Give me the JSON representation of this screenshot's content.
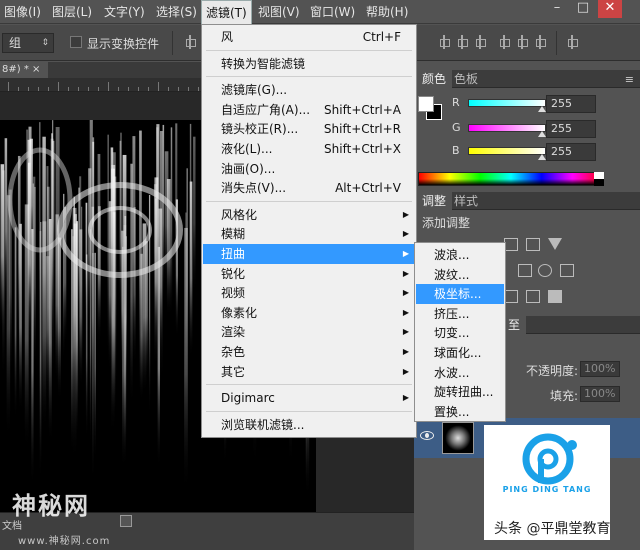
{
  "menubar": {
    "items": [
      "图像(I)",
      "图层(L)",
      "文字(Y)",
      "选择(S)",
      "滤镜(T)",
      "视图(V)",
      "窗口(W)",
      "帮助(H)"
    ],
    "active_index": 4,
    "window_controls": [
      "–",
      "□",
      "✕"
    ]
  },
  "options": {
    "auto_select_value": "组",
    "show_transform_label": "显示变换控件",
    "show_transform_checked": false
  },
  "document": {
    "tab_label": "8#) * ×",
    "status_text": "文档"
  },
  "filter_menu": {
    "items": [
      {
        "label": "风",
        "shortcut": "Ctrl+F"
      },
      {
        "separator": true
      },
      {
        "label": "转换为智能滤镜"
      },
      {
        "separator": true
      },
      {
        "label": "滤镜库(G)..."
      },
      {
        "label": "自适应广角(A)...",
        "shortcut": "Shift+Ctrl+A"
      },
      {
        "label": "镜头校正(R)...",
        "shortcut": "Shift+Ctrl+R"
      },
      {
        "label": "液化(L)...",
        "shortcut": "Shift+Ctrl+X"
      },
      {
        "label": "油画(O)..."
      },
      {
        "label": "消失点(V)...",
        "shortcut": "Alt+Ctrl+V"
      },
      {
        "separator": true
      },
      {
        "label": "风格化",
        "submenu": true
      },
      {
        "label": "模糊",
        "submenu": true
      },
      {
        "label": "扭曲",
        "submenu": true,
        "highlighted": true
      },
      {
        "label": "锐化",
        "submenu": true
      },
      {
        "label": "视频",
        "submenu": true
      },
      {
        "label": "像素化",
        "submenu": true
      },
      {
        "label": "渲染",
        "submenu": true
      },
      {
        "label": "杂色",
        "submenu": true
      },
      {
        "label": "其它",
        "submenu": true
      },
      {
        "separator": true
      },
      {
        "label": "Digimarc",
        "submenu": true
      },
      {
        "separator": true
      },
      {
        "label": "浏览联机滤镜..."
      }
    ]
  },
  "distort_submenu": {
    "items": [
      "波浪...",
      "波纹...",
      "极坐标...",
      "挤压...",
      "切变...",
      "球面化...",
      "水波...",
      "旋转扭曲...",
      "置换..."
    ],
    "highlighted_index": 2
  },
  "color_panel": {
    "tabs": [
      "颜色",
      "色板"
    ],
    "menu_icon": "≡",
    "foreground": "#ffffff",
    "background": "#000000",
    "channels": [
      {
        "label": "R",
        "value": "255",
        "gradient": "linear-gradient(to right, #00ffff, #ffffff)"
      },
      {
        "label": "G",
        "value": "255",
        "gradient": "linear-gradient(to right, #ff00ff, #ffffff)"
      },
      {
        "label": "B",
        "value": "255",
        "gradient": "linear-gradient(to right, #ffff00, #ffffff)"
      }
    ]
  },
  "adjustments_panel": {
    "tabs": [
      "调整",
      "样式"
    ],
    "add_adjustment_label": "添加调整"
  },
  "layers_panel": {
    "tab_label": "至",
    "opacity_label": "不透明度:",
    "opacity_value": "100%",
    "fill_label": "填充:",
    "fill_value": "100%"
  },
  "overlays": {
    "site_watermark": "神秘网",
    "site_url": "www.神秘网.com",
    "brand_name": "PING DING TANG",
    "author_credit": "头条 @平鼎堂教育",
    "brand_color": "#1aa1e8"
  }
}
